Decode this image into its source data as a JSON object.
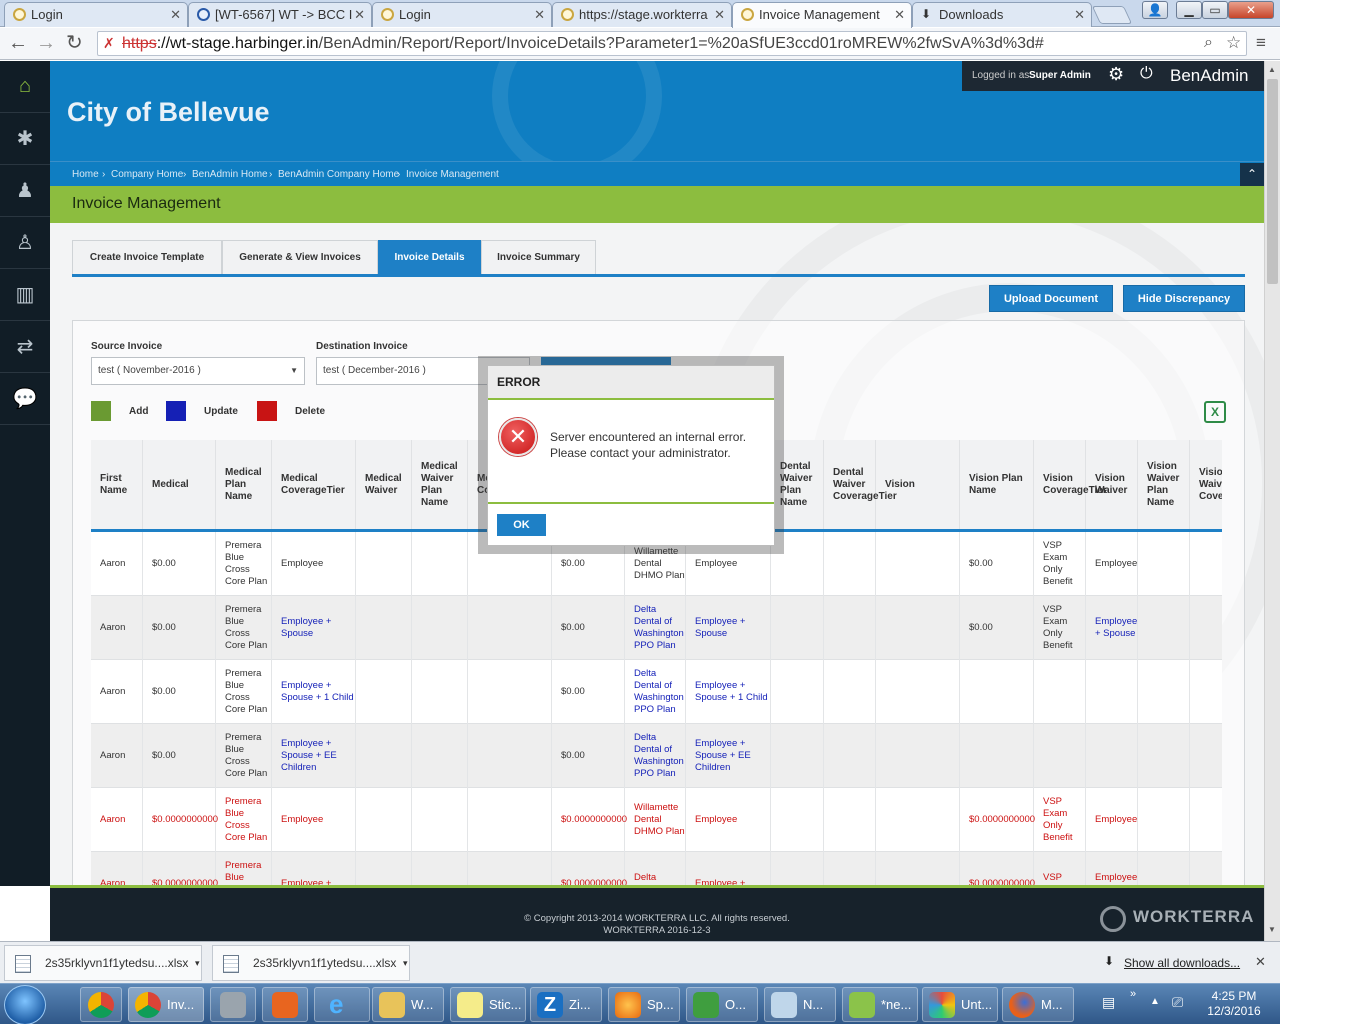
{
  "browser": {
    "tabs": [
      {
        "title": "Login",
        "active": false
      },
      {
        "title": "[WT-6567] WT -> BCC I",
        "active": false
      },
      {
        "title": "Login",
        "active": false
      },
      {
        "title": "https://stage.workterra",
        "active": false
      },
      {
        "title": "Invoice Management",
        "active": true
      },
      {
        "title": "Downloads",
        "active": false
      }
    ],
    "url": {
      "scheme": "https",
      "host": "://wt-stage.harbinger.in",
      "path": "/BenAdmin/Report/Report/InvoiceDetails?Parameter1=%20aSfUE3ccd01roMREW%2fwSvA%3d%3d#"
    }
  },
  "header": {
    "logo": "City of Bellevue",
    "logged_prefix": "Logged in as",
    "logged_user": "Super Admin",
    "app_name": "BenAdmin"
  },
  "breadcrumb": [
    "Home",
    "Company Home",
    "BenAdmin Home",
    "BenAdmin Company Home",
    "Invoice Management"
  ],
  "page_title": "Invoice Management",
  "tabs": [
    {
      "label": "Create Invoice Template"
    },
    {
      "label": "Generate & View Invoices"
    },
    {
      "label": "Invoice Details",
      "active": true
    },
    {
      "label": "Invoice Summary"
    }
  ],
  "actions": {
    "upload": "Upload Document",
    "hide": "Hide Discrepancy"
  },
  "filters": {
    "source_label": "Source Invoice",
    "source_value": "test ( November-2016 )",
    "dest_label": "Destination Invoice",
    "dest_value": "test ( December-2016 )"
  },
  "legend": {
    "add": "Add",
    "update": "Update",
    "delete": "Delete",
    "colors": {
      "add": "#6a9a32",
      "update": "#1520b5",
      "delete": "#c81414"
    }
  },
  "table": {
    "headers": [
      "First Name",
      "Medical",
      "Medical Plan Name",
      "Medical CoverageTier",
      "Medical Waiver",
      "Medical Waiver Plan Name",
      "Medical Waiver Cover",
      "",
      "",
      "",
      "Dental Waiver Plan Name",
      "Dental Waiver CoverageTier",
      "Vision",
      "Vision Plan Name",
      "Vision CoverageTier",
      "Vision Waiver",
      "Vision Waiver Plan Name",
      "Vision Waiv Cove"
    ],
    "rows": [
      {
        "style": "normal",
        "cells": [
          "Aaron",
          "$0.00",
          "Premera Blue Cross Core Plan",
          "Employee",
          "",
          "",
          "",
          "$0.00",
          "Willamette Dental DHMO Plan",
          "Employee",
          "",
          "",
          "",
          "$0.00",
          "VSP Exam Only Benefit",
          "Employee",
          "",
          ""
        ]
      },
      {
        "style": "blue",
        "cells": [
          "Aaron",
          "$0.00",
          "Premera Blue Cross Core Plan",
          "Employee + Spouse",
          "",
          "",
          "",
          "$0.00",
          "Delta Dental of Washington PPO Plan",
          "Employee + Spouse",
          "",
          "",
          "",
          "$0.00",
          "VSP Exam Only Benefit",
          "Employee + Spouse",
          "",
          ""
        ]
      },
      {
        "style": "blue",
        "cells": [
          "Aaron",
          "$0.00",
          "Premera Blue Cross Core Plan",
          "Employee + Spouse + 1 Child",
          "",
          "",
          "",
          "$0.00",
          "Delta Dental of Washington PPO Plan",
          "Employee + Spouse + 1 Child",
          "",
          "",
          "",
          "",
          "",
          "",
          "",
          ""
        ]
      },
      {
        "style": "blue",
        "cells": [
          "Aaron",
          "$0.00",
          "Premera Blue Cross Core Plan",
          "Employee + Spouse + EE Children",
          "",
          "",
          "",
          "$0.00",
          "Delta Dental of Washington PPO Plan",
          "Employee + Spouse + EE Children",
          "",
          "",
          "",
          "",
          "",
          "",
          "",
          ""
        ]
      },
      {
        "style": "red",
        "cells": [
          "Aaron",
          "$0.0000000000",
          "Premera Blue Cross Core Plan",
          "Employee",
          "",
          "",
          "",
          "$0.0000000000",
          "Willamette Dental DHMO Plan",
          "Employee",
          "",
          "",
          "",
          "$0.0000000000",
          "VSP Exam Only Benefit",
          "Employee",
          "",
          ""
        ]
      },
      {
        "style": "red",
        "cells": [
          "Aaron",
          "$0.0000000000",
          "Premera Blue Cross Core Plan",
          "Employee +",
          "",
          "",
          "",
          "$0.0000000000",
          "Delta Dental of",
          "Employee +",
          "",
          "",
          "",
          "$0.0000000000",
          "VSP Exam",
          "Employee +",
          "",
          ""
        ]
      }
    ]
  },
  "modal": {
    "title": "ERROR",
    "message": "Server encountered an internal error. Please contact your administrator.",
    "ok": "OK"
  },
  "footer": {
    "copyright": "© Copyright 2013-2014 WORKTERRA LLC. All rights reserved.",
    "build": "WORKTERRA 2016-12-3",
    "brand": "WORKTERRA"
  },
  "downloads": {
    "items": [
      "2s35rklyvn1f1ytedsu....xlsx",
      "2s35rklyvn1f1ytedsu....xlsx"
    ],
    "show_all": "Show all downloads..."
  },
  "taskbar": {
    "items": [
      "Inv...",
      "W...",
      "Stic...",
      "Zi...",
      "Sp...",
      "O...",
      "N...",
      "*ne...",
      "Unt...",
      "M..."
    ],
    "time": "4:25 PM",
    "date": "12/3/2016"
  }
}
